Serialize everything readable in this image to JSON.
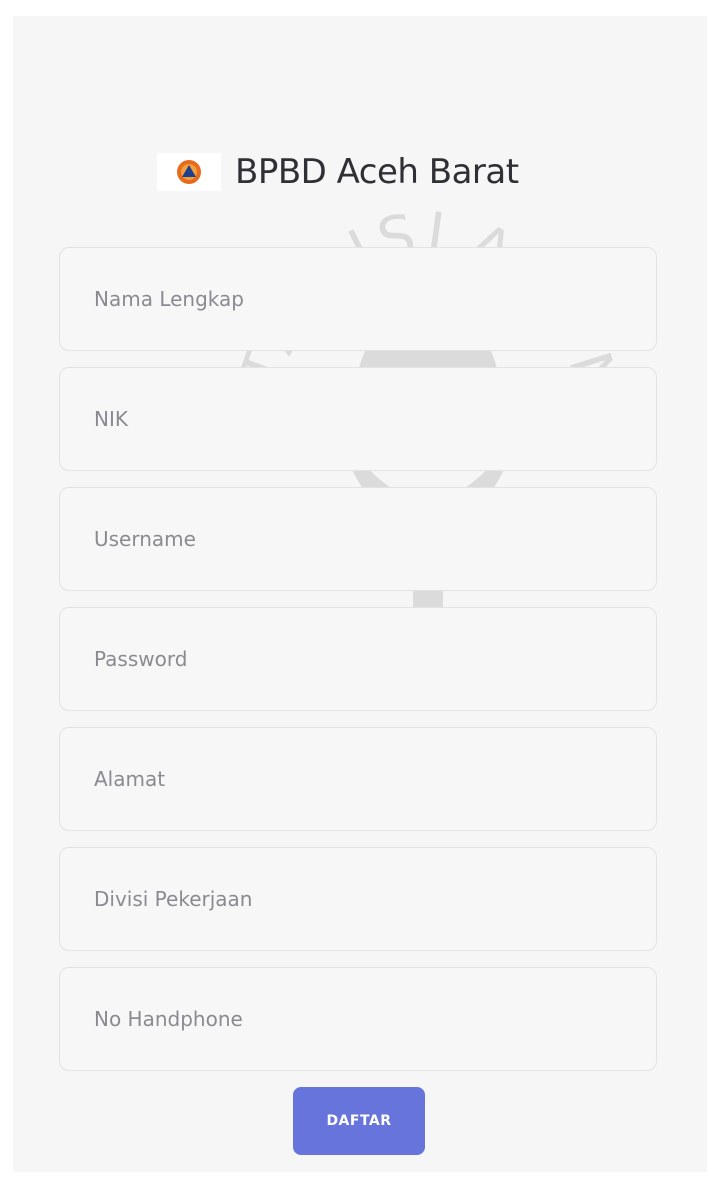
{
  "brand": {
    "logo_icon": "bpbd-logo-icon",
    "title": "BPBD Aceh Barat"
  },
  "watermark": {
    "top_text": "ISLAM",
    "left_text": "UNIVERSITAS",
    "right_text": "INDONESIA"
  },
  "form": {
    "fields": [
      {
        "name": "nama-lengkap",
        "placeholder": "Nama Lengkap",
        "value": ""
      },
      {
        "name": "nik",
        "placeholder": "NIK",
        "value": ""
      },
      {
        "name": "username",
        "placeholder": "Username",
        "value": ""
      },
      {
        "name": "password",
        "placeholder": "Password",
        "value": ""
      },
      {
        "name": "alamat",
        "placeholder": "Alamat",
        "value": ""
      },
      {
        "name": "divisi-pekerjaan",
        "placeholder": "Divisi Pekerjaan",
        "value": ""
      },
      {
        "name": "no-handphone",
        "placeholder": "No Handphone",
        "value": ""
      }
    ],
    "submit_label": "DAFTAR"
  },
  "colors": {
    "accent": "#6674dc",
    "background": "#f6f6f7",
    "logo_orange": "#e86a1c"
  }
}
